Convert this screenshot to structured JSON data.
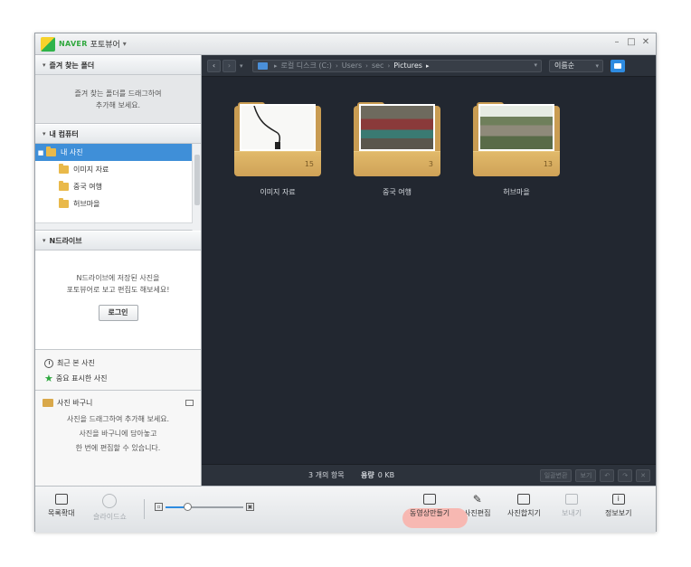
{
  "titlebar": {
    "brand": "NAVER",
    "title": "포토뷰어",
    "caret": "▾",
    "min": "–",
    "max": "□",
    "close": "✕"
  },
  "sidebar": {
    "favorites": {
      "header": "즐겨 찾는 폴더",
      "hint_line1": "즐겨 찾는 폴더를 드래그하여",
      "hint_line2": "추가해 보세요."
    },
    "my_computer": {
      "header": "내 컴퓨터",
      "items": [
        {
          "label": "내 사진",
          "selected": true
        },
        {
          "label": "이미지 자료"
        },
        {
          "label": "중국 여행"
        },
        {
          "label": "허브마을"
        }
      ]
    },
    "ndrive": {
      "header": "N드라이브",
      "line1": "N드라이브에 저장된 사진을",
      "line2": "포토뷰어로 보고 편집도 해보세요!",
      "login": "로그인"
    },
    "quick": {
      "recent": "최근 본 사진",
      "starred": "중요 표시한 사진"
    },
    "basket": {
      "title": "사진 바구니",
      "line1": "사진을 드래그하여 추가해 보세요.",
      "line2": "사진을 바구니에 담아놓고",
      "line3": "한 번에 편집할 수 있습니다."
    }
  },
  "navbar": {
    "back": "‹",
    "forward": "›",
    "history": "▾",
    "path": [
      "로컬 디스크 (C:)",
      "Users",
      "sec",
      "Pictures"
    ],
    "sort": "이름순"
  },
  "folders": [
    {
      "name": "이미지 자료",
      "count": "15"
    },
    {
      "name": "중국 여행",
      "count": "3"
    },
    {
      "name": "허브마을",
      "count": "13"
    }
  ],
  "status": {
    "count": "3 개의 항목",
    "size_label": "용량",
    "size_value": "0 KB",
    "btn1": "일괄변환",
    "btn2": "보기",
    "btn3": "↶",
    "btn4": "↷",
    "btn5": "✕"
  },
  "bottom": {
    "list_expand": "목록확대",
    "slideshow": "슬라이드쇼",
    "zoom_min": "▫",
    "zoom_max": "▣",
    "zoom_level": 0.28,
    "video": "동영상만들기",
    "edit": "사진편집",
    "merge": "사진합치기",
    "share": "보내기",
    "info": "정보보기"
  },
  "colors": {
    "accent": "#2e8be0",
    "selection": "#3f8fd8",
    "brand_green": "#31a83f",
    "folder": "#c99c52",
    "highlight": "#f7b8b2"
  }
}
